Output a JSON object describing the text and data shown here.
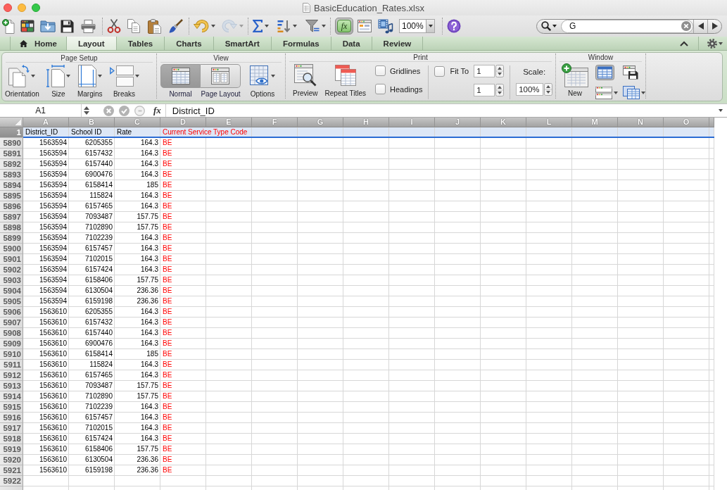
{
  "window": {
    "title": "BasicEducation_Rates.xlsx"
  },
  "toolbar": {
    "undo": {
      "disabled": false
    },
    "redo": {
      "disabled": true
    },
    "formula_builder": {
      "label": "fx",
      "selected": true
    },
    "zoom": "100%",
    "search": {
      "value": "G"
    }
  },
  "ribbon": {
    "tabs": [
      {
        "label": "Home",
        "selected": false
      },
      {
        "label": "Layout",
        "selected": true
      },
      {
        "label": "Tables",
        "selected": false
      },
      {
        "label": "Charts",
        "selected": false
      },
      {
        "label": "SmartArt",
        "selected": false
      },
      {
        "label": "Formulas",
        "selected": false
      },
      {
        "label": "Data",
        "selected": false
      },
      {
        "label": "Review",
        "selected": false
      }
    ],
    "page_setup": {
      "title": "Page Setup",
      "buttons": [
        {
          "label": "Orientation"
        },
        {
          "label": "Size"
        },
        {
          "label": "Margins"
        },
        {
          "label": "Breaks"
        }
      ]
    },
    "view": {
      "title": "View",
      "modes": [
        {
          "label": "Normal",
          "selected": true
        },
        {
          "label": "Page Layout",
          "selected": false
        }
      ],
      "options": {
        "label": "Options"
      }
    },
    "print": {
      "title": "Print",
      "buttons": [
        {
          "label": "Preview"
        },
        {
          "label": "Repeat Titles"
        }
      ],
      "checkboxes": [
        {
          "label": "Gridlines",
          "checked": false
        },
        {
          "label": "Headings",
          "checked": false
        }
      ],
      "fit_to": {
        "label": "Fit To",
        "checked": false,
        "pages_wide": "1",
        "pages_tall": "1"
      },
      "scale": {
        "label": "Scale:",
        "value": "100%"
      }
    },
    "window_group": {
      "title": "Window",
      "new": {
        "label": "New"
      }
    }
  },
  "formula_bar": {
    "name_box": "A1",
    "function_label": "fx",
    "content": "District_ID"
  },
  "sheet": {
    "columns": [
      {
        "label": "A"
      },
      {
        "label": "B"
      },
      {
        "label": "C"
      },
      {
        "label": "D",
        "color": "#ff0000"
      },
      {
        "label": "E"
      },
      {
        "label": "F"
      },
      {
        "label": "G"
      },
      {
        "label": "H"
      },
      {
        "label": "I"
      },
      {
        "label": "J"
      },
      {
        "label": "K"
      },
      {
        "label": "L"
      },
      {
        "label": "M"
      },
      {
        "label": "N"
      },
      {
        "label": "O"
      }
    ],
    "rows": [
      {
        "number": "1",
        "cells": [
          "District_ID",
          "School ID",
          "Rate",
          "Current Service Type Code"
        ],
        "selected": true
      },
      {
        "number": "5890",
        "cells": [
          "1563594",
          "6205355",
          "164.3",
          "BE"
        ],
        "selected": false
      },
      {
        "number": "5891",
        "cells": [
          "1563594",
          "6157432",
          "164.3",
          "BE"
        ],
        "selected": false
      },
      {
        "number": "5892",
        "cells": [
          "1563594",
          "6157440",
          "164.3",
          "BE"
        ],
        "selected": false
      },
      {
        "number": "5893",
        "cells": [
          "1563594",
          "6900476",
          "164.3",
          "BE"
        ],
        "selected": false
      },
      {
        "number": "5894",
        "cells": [
          "1563594",
          "6158414",
          "185",
          "BE"
        ],
        "selected": false
      },
      {
        "number": "5895",
        "cells": [
          "1563594",
          "115824",
          "164.3",
          "BE"
        ],
        "selected": false
      },
      {
        "number": "5896",
        "cells": [
          "1563594",
          "6157465",
          "164.3",
          "BE"
        ],
        "selected": false
      },
      {
        "number": "5897",
        "cells": [
          "1563594",
          "7093487",
          "157.75",
          "BE"
        ],
        "selected": false
      },
      {
        "number": "5898",
        "cells": [
          "1563594",
          "7102890",
          "157.75",
          "BE"
        ],
        "selected": false
      },
      {
        "number": "5899",
        "cells": [
          "1563594",
          "7102239",
          "164.3",
          "BE"
        ],
        "selected": false
      },
      {
        "number": "5900",
        "cells": [
          "1563594",
          "6157457",
          "164.3",
          "BE"
        ],
        "selected": false
      },
      {
        "number": "5901",
        "cells": [
          "1563594",
          "7102015",
          "164.3",
          "BE"
        ],
        "selected": false
      },
      {
        "number": "5902",
        "cells": [
          "1563594",
          "6157424",
          "164.3",
          "BE"
        ],
        "selected": false
      },
      {
        "number": "5903",
        "cells": [
          "1563594",
          "6158406",
          "157.75",
          "BE"
        ],
        "selected": false
      },
      {
        "number": "5904",
        "cells": [
          "1563594",
          "6130504",
          "236.36",
          "BE"
        ],
        "selected": false
      },
      {
        "number": "5905",
        "cells": [
          "1563594",
          "6159198",
          "236.36",
          "BE"
        ],
        "selected": false
      },
      {
        "number": "5906",
        "cells": [
          "1563610",
          "6205355",
          "164.3",
          "BE"
        ],
        "selected": false
      },
      {
        "number": "5907",
        "cells": [
          "1563610",
          "6157432",
          "164.3",
          "BE"
        ],
        "selected": false
      },
      {
        "number": "5908",
        "cells": [
          "1563610",
          "6157440",
          "164.3",
          "BE"
        ],
        "selected": false
      },
      {
        "number": "5909",
        "cells": [
          "1563610",
          "6900476",
          "164.3",
          "BE"
        ],
        "selected": false
      },
      {
        "number": "5910",
        "cells": [
          "1563610",
          "6158414",
          "185",
          "BE"
        ],
        "selected": false
      },
      {
        "number": "5911",
        "cells": [
          "1563610",
          "115824",
          "164.3",
          "BE"
        ],
        "selected": false
      },
      {
        "number": "5912",
        "cells": [
          "1563610",
          "6157465",
          "164.3",
          "BE"
        ],
        "selected": false
      },
      {
        "number": "5913",
        "cells": [
          "1563610",
          "7093487",
          "157.75",
          "BE"
        ],
        "selected": false
      },
      {
        "number": "5914",
        "cells": [
          "1563610",
          "7102890",
          "157.75",
          "BE"
        ],
        "selected": false
      },
      {
        "number": "5915",
        "cells": [
          "1563610",
          "7102239",
          "164.3",
          "BE"
        ],
        "selected": false
      },
      {
        "number": "5916",
        "cells": [
          "1563610",
          "6157457",
          "164.3",
          "BE"
        ],
        "selected": false
      },
      {
        "number": "5917",
        "cells": [
          "1563610",
          "7102015",
          "164.3",
          "BE"
        ],
        "selected": false
      },
      {
        "number": "5918",
        "cells": [
          "1563610",
          "6157424",
          "164.3",
          "BE"
        ],
        "selected": false
      },
      {
        "number": "5919",
        "cells": [
          "1563610",
          "6158406",
          "157.75",
          "BE"
        ],
        "selected": false
      },
      {
        "number": "5920",
        "cells": [
          "1563610",
          "6130504",
          "236.36",
          "BE"
        ],
        "selected": false
      },
      {
        "number": "5921",
        "cells": [
          "1563610",
          "6159198",
          "236.36",
          "BE"
        ],
        "selected": false
      },
      {
        "number": "5922",
        "selected": false
      }
    ]
  }
}
